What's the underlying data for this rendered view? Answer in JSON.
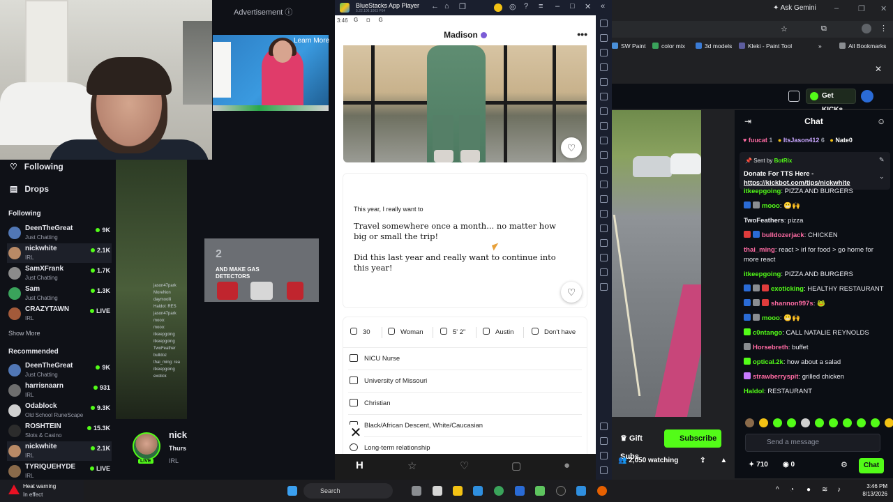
{
  "left": {
    "advertisement_label": "Advertisement",
    "learn_more": "Learn More",
    "ad2_line1": "2",
    "ad2_line2": "AND MAKE GAS DETECTORS",
    "nav": [
      {
        "label": "Following",
        "icon": "heart-icon"
      },
      {
        "label": "Drops",
        "icon": "drops-icon"
      }
    ],
    "following_title": "Following",
    "following": [
      {
        "name": "DeenTheGreat",
        "sub": "Just Chatting",
        "viewers": "9K"
      },
      {
        "name": "nickwhite",
        "sub": "IRL",
        "viewers": "2.1K"
      },
      {
        "name": "SamXFrank",
        "sub": "Just Chatting",
        "viewers": "1.7K"
      },
      {
        "name": "Sam",
        "sub": "Just Chatting",
        "viewers": "1.3K"
      },
      {
        "name": "CRAZYTAWN",
        "sub": "IRL",
        "viewers": "LIVE"
      }
    ],
    "show_more": "Show More",
    "recommended_title": "Recommended",
    "recommended": [
      {
        "name": "DeenTheGreat",
        "sub": "Just Chatting",
        "viewers": "9K"
      },
      {
        "name": "harrisnaarn",
        "sub": "IRL",
        "viewers": "931"
      },
      {
        "name": "Odablock",
        "sub": "Old School RuneScape",
        "viewers": "9.3K"
      },
      {
        "name": "ROSHTEIN",
        "sub": "Slots & Casino",
        "viewers": "15.3K"
      },
      {
        "name": "nickwhite",
        "sub": "IRL",
        "viewers": "2.1K"
      },
      {
        "name": "TYRIQUEHYDE",
        "sub": "IRL",
        "viewers": "LIVE"
      }
    ],
    "mid_chat": [
      "jason47park",
      "MoreNon",
      "daymoolli",
      "Haldol: RES",
      "jason47park",
      "mooo:",
      "mooo:",
      "itkeepgoing",
      "itkeepgoing",
      "TwoFeather",
      "bulldoz",
      "thai_ming: rea",
      "itkeepgoing",
      "exotick"
    ],
    "streamer": {
      "name": "nick",
      "title": "Thurs",
      "category": "IRL",
      "live": "LIVE"
    },
    "heat_warning": "Heat warning",
    "heat_sub": "In effect"
  },
  "bluestacks": {
    "title": "BlueStacks App Player",
    "version": "5.22.106.1003 P64",
    "status_time": "3:46",
    "status_icons": "G ◘ G",
    "profile_name": "Madison",
    "more": "•••",
    "prompt_question": "This year, I really want to",
    "prompt_answer": "Travel somewhere once a month... no matter how big or small the trip!\n\nDid this last year and really want to continue into this year!",
    "vitals": [
      {
        "icon": "age-icon",
        "text": "30"
      },
      {
        "icon": "gender-icon",
        "text": "Woman"
      },
      {
        "icon": "height-icon",
        "text": "5' 2\""
      },
      {
        "icon": "location-icon",
        "text": "Austin"
      },
      {
        "icon": "children-icon",
        "text": "Don't have"
      }
    ],
    "details": [
      {
        "icon": "job-icon",
        "text": "NICU Nurse"
      },
      {
        "icon": "school-icon",
        "text": "University of Missouri"
      },
      {
        "icon": "religion-icon",
        "text": "Christian"
      },
      {
        "icon": "ethnicity-icon",
        "text": "Black/African Descent, White/Caucasian"
      },
      {
        "icon": "search-icon",
        "text": "Long-term relationship"
      }
    ],
    "close": "✕"
  },
  "right": {
    "ask_gemini": "Ask Gemini",
    "bookmarks": [
      {
        "label": "SW Paint",
        "color": "#4a90d9"
      },
      {
        "label": "color mix",
        "color": "#3aa35b"
      },
      {
        "label": "3d models",
        "color": "#3a7bd5"
      },
      {
        "label": "Kleki - Paint Tool",
        "color": "#5d5d9e"
      }
    ],
    "all_bookmarks": "All Bookmarks",
    "get_kicks": "Get KICKs",
    "chat_title": "Chat",
    "pinned": [
      {
        "user": "fuucat",
        "count": "1"
      },
      {
        "user": "ItsJason412",
        "count": "6"
      },
      {
        "user": "Nate0",
        "count": ""
      }
    ],
    "sent_by_label": "Sent by",
    "sent_by_bot": "BotRix",
    "donate_text": "Donate For TTS Here -",
    "donate_link": "https://kickbot.com/tips/nickwhite",
    "messages": [
      {
        "user": "itkeepgoing",
        "text": ": PIZZA AND BURGERS",
        "color": "#53fc18"
      },
      {
        "user": "mooo",
        "text": ": 😬🙌",
        "color": "#53fc18"
      },
      {
        "user": "TwoFeathers",
        "text": ": pizza",
        "color": "#e9eaf0"
      },
      {
        "user": "bulldozerjack",
        "text": ": CHICKEN",
        "color": "#ff6ba3"
      },
      {
        "user": "thai_ming",
        "text": ": react > irl for food > go home for more react",
        "color": "#ff6ba3"
      },
      {
        "user": "itkeepgoing",
        "text": ": PIZZA AND BURGERS",
        "color": "#53fc18"
      },
      {
        "user": "exoticking",
        "text": ": HEALTHY RESTAURANT",
        "color": "#53fc18"
      },
      {
        "user": "shannon997s",
        "text": ": 🐸",
        "color": "#ff6ba3"
      },
      {
        "user": "mooo",
        "text": ": 😬🙌",
        "color": "#53fc18"
      },
      {
        "user": "c0ntango",
        "text": ": CALL NATALIE REYNOLDS",
        "color": "#53fc18"
      },
      {
        "user": "Horsebreth",
        "text": ": buffet",
        "color": "#ff6ba3"
      },
      {
        "user": "optical.2k",
        "text": ": how about a salad",
        "color": "#53fc18"
      },
      {
        "user": "strawberryspit",
        "text": ": grilled chicken",
        "color": "#ff6ba3"
      },
      {
        "user": "Haldol",
        "text": ": RESTAURANT",
        "color": "#53fc18"
      }
    ],
    "gift_subs": "Gift Subs",
    "subscribe": "Subscribe",
    "send_placeholder": "Send a message",
    "watching": "2,050 watching",
    "count_a": "710",
    "count_b": "0",
    "chat_button": "Chat"
  },
  "taskbar": {
    "search": "Search",
    "time": "3:46 PM",
    "date": "8/13/2026"
  }
}
